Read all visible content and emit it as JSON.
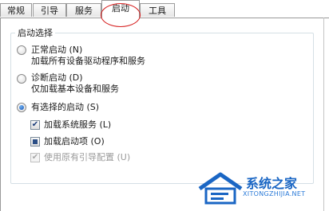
{
  "tabs": [
    {
      "label": "常规",
      "active": false
    },
    {
      "label": "引导",
      "active": false
    },
    {
      "label": "服务",
      "active": false
    },
    {
      "label": "启动",
      "active": true
    },
    {
      "label": "工具",
      "active": false
    }
  ],
  "startup_group": {
    "legend": "启动选择",
    "options": [
      {
        "label": "正常启动 (N)",
        "description": "加载所有设备驱动程序和服务",
        "selected": false
      },
      {
        "label": "诊断启动 (D)",
        "description": "仅加载基本设备和服务",
        "selected": false
      },
      {
        "label": "有选择的启动 (S)",
        "selected": true
      }
    ],
    "checkboxes": [
      {
        "label": "加载系统服务 (L)",
        "state": "checked"
      },
      {
        "label": "加载启动项 (O)",
        "state": "indeterminate"
      },
      {
        "label": "使用原有引导配置 (U)",
        "state": "checked-disabled"
      }
    ]
  },
  "watermark": {
    "name": "系统之家",
    "url": "XITONGZHIJIA.NET"
  },
  "colors": {
    "annotation_circle": "#d61f1f",
    "brand": "#1a66c4"
  }
}
